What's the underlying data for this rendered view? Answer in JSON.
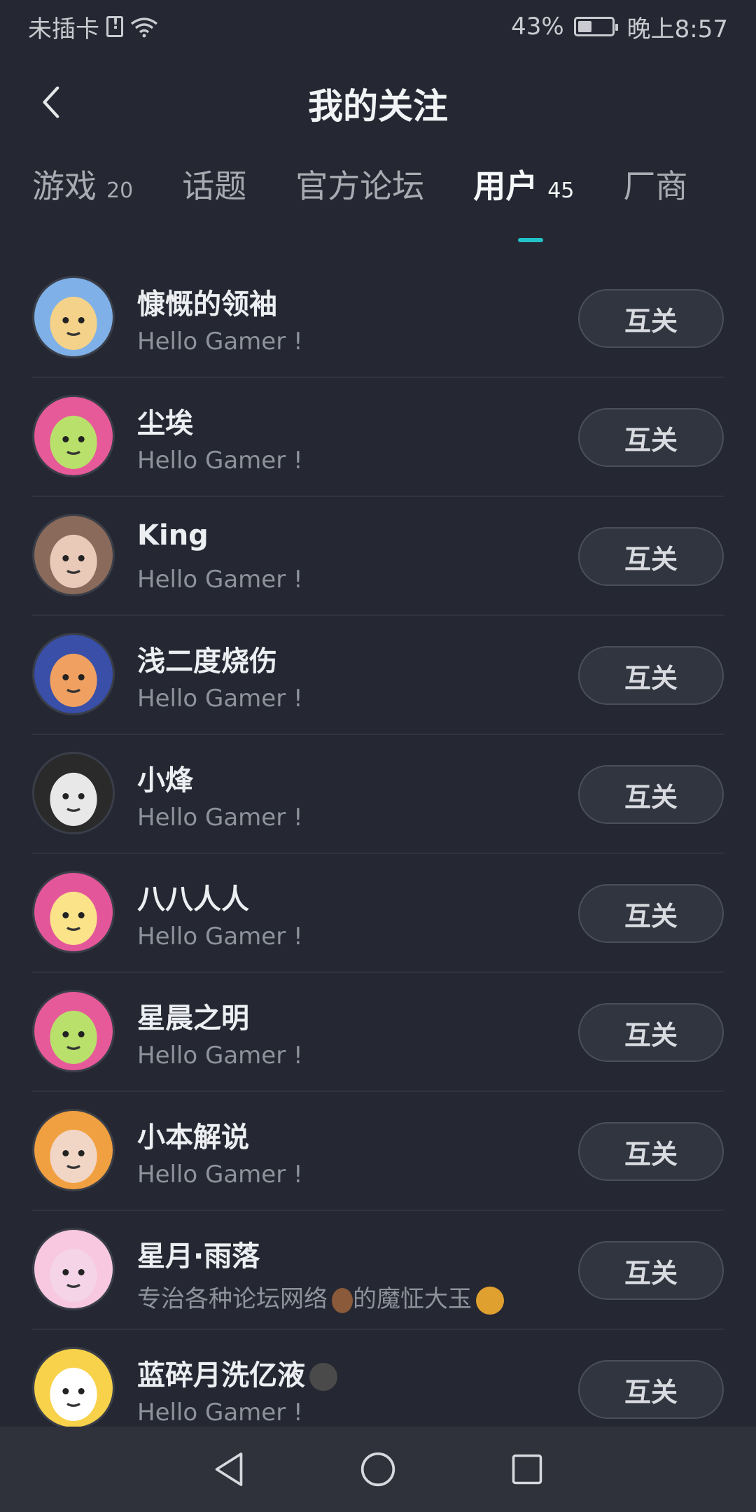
{
  "status": {
    "carrier": "未插卡",
    "battery": "43%",
    "battery_level": 0.43,
    "time": "晚上8:57"
  },
  "header": {
    "title": "我的关注"
  },
  "tabs": [
    {
      "label": "游戏",
      "count": "20"
    },
    {
      "label": "话题",
      "count": ""
    },
    {
      "label": "官方论坛",
      "count": ""
    },
    {
      "label": "用户",
      "count": "45"
    },
    {
      "label": "厂商",
      "count": ""
    }
  ],
  "active_tab": "用户",
  "follow_label": "互关",
  "users": [
    {
      "name": "慷慨的领袖",
      "bio": "Hello Gamer !",
      "color": "#7fb0e8"
    },
    {
      "name": "尘埃",
      "bio": "Hello Gamer !",
      "color": "#e75a9a"
    },
    {
      "name": "King",
      "bio": "Hello Gamer !",
      "color": "#8a6a5a"
    },
    {
      "name": "浅二度烧伤",
      "bio": "Hello Gamer !",
      "color": "#3a4fa8"
    },
    {
      "name": "小烽",
      "bio": "Hello Gamer !",
      "color": "#2a2a2a"
    },
    {
      "name": "八八人人",
      "bio": "Hello Gamer !",
      "color": "#e3579a"
    },
    {
      "name": "星晨之明",
      "bio": "Hello Gamer !",
      "color": "#e75a9a"
    },
    {
      "name": "小本解说",
      "bio": "Hello Gamer !",
      "color": "#f0a040"
    },
    {
      "name": "星月·雨落",
      "bio": "专治各种论坛网络",
      "bio2": "的魔怔大玉",
      "color": "#f7c8e0"
    },
    {
      "name": "蓝碎月洗亿液",
      "bio": "Hello Gamer !",
      "color": "#f7d24a"
    }
  ]
}
